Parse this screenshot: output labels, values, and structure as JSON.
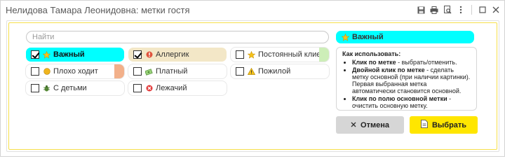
{
  "window": {
    "title": "Нелидова Тамара Леонидовна: метки гостя"
  },
  "toolbar": {
    "icons": [
      "save-icon",
      "print-icon",
      "preview-icon",
      "more-icon",
      "restore-icon",
      "close-icon"
    ]
  },
  "search": {
    "placeholder": "Найти",
    "value": ""
  },
  "tags": [
    {
      "label": "Важный",
      "checked": true,
      "icon": "star-icon",
      "style": "cyan"
    },
    {
      "label": "Аллергик",
      "checked": true,
      "icon": "red-circle-icon",
      "style": "beige"
    },
    {
      "label": "Постоянный клиент",
      "checked": false,
      "icon": "star-icon",
      "style": "plain",
      "accent": "#cdeeb8"
    },
    {
      "label": "Плохо ходит",
      "checked": false,
      "icon": "yellow-circle-icon",
      "style": "plain",
      "accent": "#f2b08a"
    },
    {
      "label": "Платный",
      "checked": false,
      "icon": "money-icon",
      "style": "plain"
    },
    {
      "label": "Пожилой",
      "checked": false,
      "icon": "warning-icon",
      "style": "plain"
    },
    {
      "label": "С детьми",
      "checked": false,
      "icon": "bug-icon",
      "style": "plain"
    },
    {
      "label": "Лежачий",
      "checked": false,
      "icon": "red-x-icon",
      "style": "plain"
    }
  ],
  "main_tag": {
    "label": "Важный",
    "icon": "star-icon",
    "color": "#00ffff"
  },
  "help": {
    "header": "Как использовать:",
    "items": [
      {
        "bold": "Клик по метке",
        "text": " - выбрать/отменить."
      },
      {
        "bold": "Двойной клик по метке",
        "text": " - сделать метку основной (при наличии картинки). Первая выбранная метка автоматически становится основной."
      },
      {
        "bold": "Клик по полю основной метки",
        "text": " - очистить основную метку."
      }
    ]
  },
  "buttons": {
    "cancel": {
      "label": "Отмена",
      "icon": "x-icon",
      "color": "#d6d6d6"
    },
    "select": {
      "label": "Выбрать",
      "icon": "document-icon",
      "color": "#ffe600"
    }
  }
}
